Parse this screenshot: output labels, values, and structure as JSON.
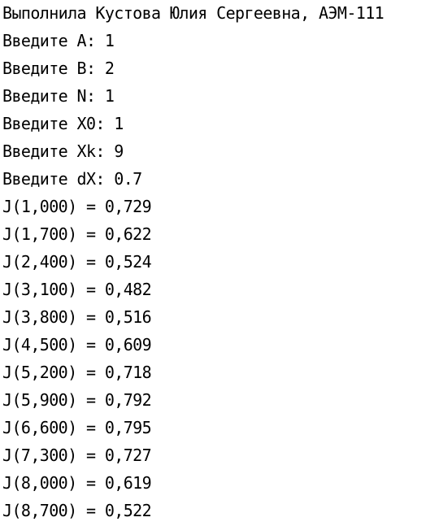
{
  "console": {
    "lines": [
      "Выполнила Кустова Юлия Сергеевна, АЭМ-111",
      "Введите A: 1",
      "Введите B: 2",
      "Введите N: 1",
      "Введите X0: 1",
      "Введите Xk: 9",
      "Введите dX: 0.7",
      "J(1,000) = 0,729",
      "J(1,700) = 0,622",
      "J(2,400) = 0,524",
      "J(3,100) = 0,482",
      "J(3,800) = 0,516",
      "J(4,500) = 0,609",
      "J(5,200) = 0,718",
      "J(5,900) = 0,792",
      "J(6,600) = 0,795",
      "J(7,300) = 0,727",
      "J(8,000) = 0,619",
      "J(8,700) = 0,522"
    ]
  },
  "colors": {
    "background": "#ffffff",
    "text": "#000000"
  }
}
